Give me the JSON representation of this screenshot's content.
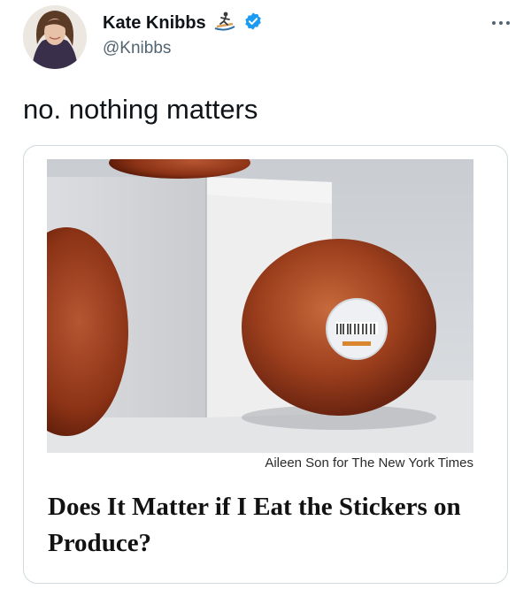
{
  "user": {
    "display_name": "Kate Knibbs",
    "handle": "@Knibbs",
    "verified": true,
    "name_emoji": "surfer-icon"
  },
  "tweet": {
    "text": "no. nothing matters"
  },
  "card": {
    "photo_credit": "Aileen Son for The New York Times",
    "headline": "Does It Matter if I Eat the Stickers on Produce?"
  },
  "colors": {
    "verified_badge": "#1d9bf0",
    "text_primary": "#0f1419",
    "text_secondary": "#536471",
    "card_border": "#cfd9de"
  }
}
